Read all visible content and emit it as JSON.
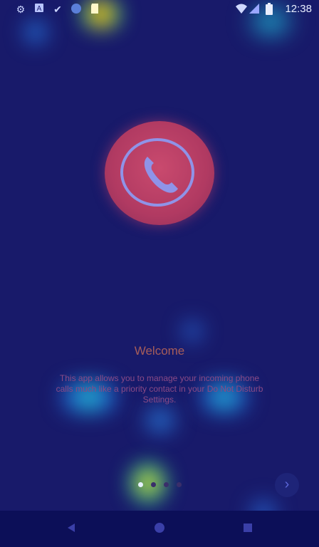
{
  "status_bar": {
    "left_icons": [
      "gear-icon",
      "a-box-icon",
      "check-icon",
      "circle-icon",
      "sd-card-icon"
    ],
    "right_icons": [
      "wifi-icon",
      "signal-icon",
      "battery-icon"
    ],
    "time": "12:38"
  },
  "intro": {
    "title": "Welcome",
    "body": "This app allows you to manage your incoming phone calls much like a priority contact in your Do Not Disturb Settings."
  },
  "pager": {
    "page_count": 4,
    "current_page": 1,
    "next_icon": "chevron-right-icon"
  },
  "nav_bar": {
    "back_icon": "back-triangle-icon",
    "home_icon": "home-circle-icon",
    "recents_icon": "recents-square-icon"
  },
  "colors": {
    "background": "#181a6a",
    "logo": "#b13a62",
    "title": "#a65d5a",
    "body": "#8a4a86"
  }
}
